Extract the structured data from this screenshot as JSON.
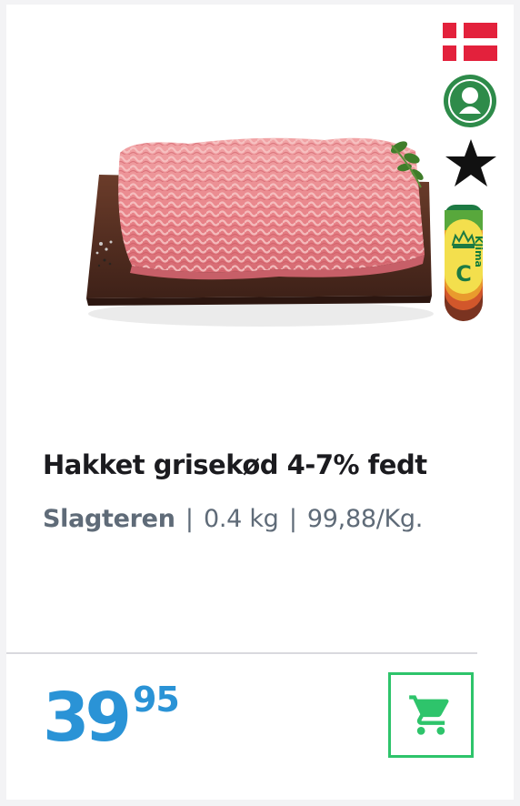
{
  "product": {
    "title": "Hakket grisekød 4-7% fedt",
    "brand": "Slagteren",
    "separator": "|",
    "weight": "0.4 kg",
    "unit_price": "99,88/Kg."
  },
  "price": {
    "major": "39",
    "minor": "95",
    "color": "#2a93d6"
  },
  "badges": {
    "origin_flag": "danish-flag-icon",
    "organic": "organic-badge-icon",
    "star": "star-icon",
    "klima_label": "Klima",
    "klima_grade": "C"
  },
  "cart": {
    "icon": "shopping-cart-icon",
    "color": "#2ec46b"
  }
}
